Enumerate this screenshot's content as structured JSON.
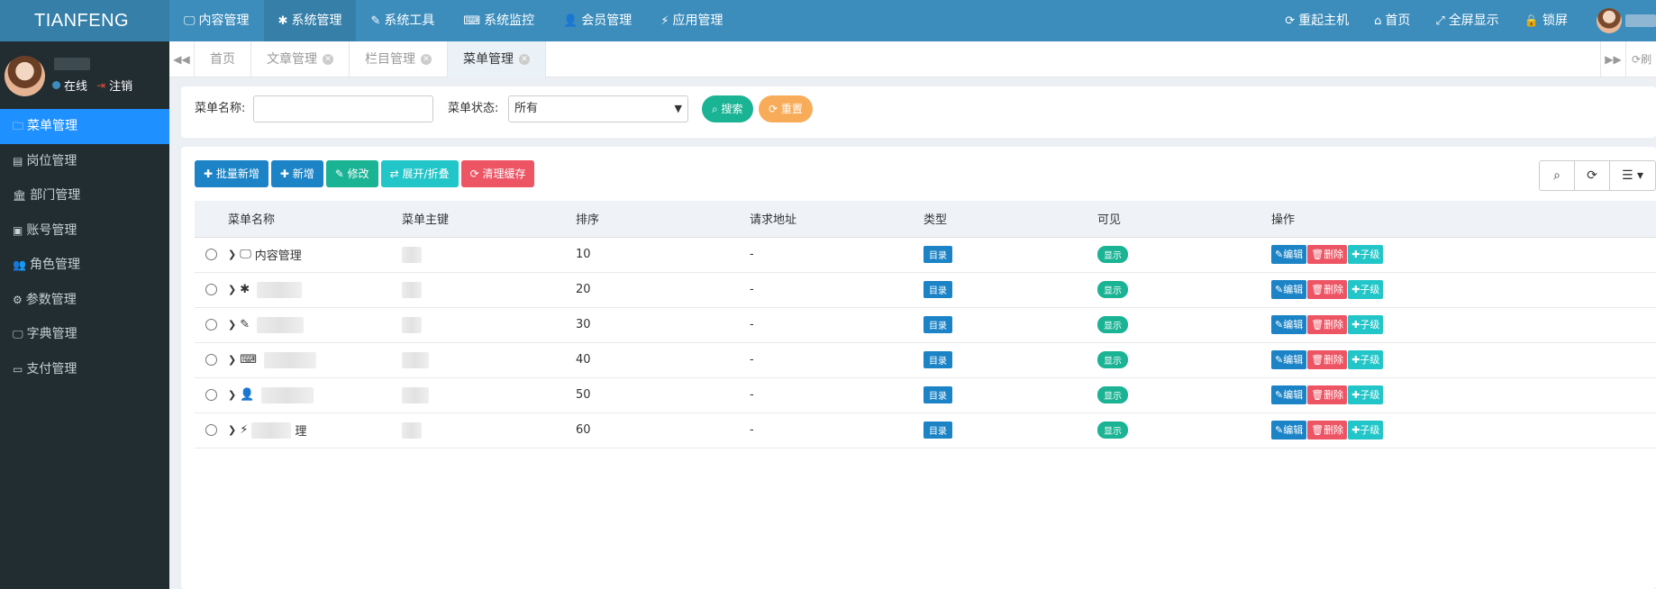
{
  "header": {
    "logo": "TIANFENG",
    "nav": [
      {
        "icon": "monitor-icon",
        "glyph": "🖵",
        "label": "内容管理"
      },
      {
        "icon": "gear-icon",
        "glyph": "✱",
        "label": "系统管理"
      },
      {
        "icon": "wrench-icon",
        "glyph": "✎",
        "label": "系统工具"
      },
      {
        "icon": "keyboard-icon",
        "glyph": "⌨",
        "label": "系统监控"
      },
      {
        "icon": "user-icon",
        "glyph": "👤",
        "label": "会员管理"
      },
      {
        "icon": "plug-icon",
        "glyph": "⚡",
        "label": "应用管理"
      }
    ],
    "right": [
      {
        "icon": "refresh-icon",
        "glyph": "⟳",
        "label": "重起主机"
      },
      {
        "icon": "home-icon",
        "glyph": "⌂",
        "label": "首页"
      },
      {
        "icon": "fullscreen-icon",
        "glyph": "⤢",
        "label": "全屏显示"
      },
      {
        "icon": "lock-icon",
        "glyph": "🔒",
        "label": "锁屏"
      }
    ]
  },
  "sidebar": {
    "status_online": "在线",
    "logout": "注销",
    "items": [
      {
        "icon": "folder-icon",
        "glyph": "🗀",
        "label": "菜单管理"
      },
      {
        "icon": "id-card-icon",
        "glyph": "▤",
        "label": "岗位管理"
      },
      {
        "icon": "bank-icon",
        "glyph": "🏛",
        "label": "部门管理"
      },
      {
        "icon": "account-card-icon",
        "glyph": "▣",
        "label": "账号管理"
      },
      {
        "icon": "users-icon",
        "glyph": "👥",
        "label": "角色管理"
      },
      {
        "icon": "cogs-icon",
        "glyph": "⚙",
        "label": "参数管理"
      },
      {
        "icon": "monitor-icon",
        "glyph": "🖵",
        "label": "字典管理"
      },
      {
        "icon": "money-icon",
        "glyph": "▭",
        "label": "支付管理"
      }
    ]
  },
  "tabs": [
    {
      "label": "首页"
    },
    {
      "label": "文章管理"
    },
    {
      "label": "栏目管理"
    },
    {
      "label": "菜单管理"
    }
  ],
  "tab_refresh": "刷",
  "search": {
    "name_label": "菜单名称:",
    "name_value": "",
    "status_label": "菜单状态:",
    "status_value": "所有",
    "search_btn": "搜索",
    "reset_btn": "重置"
  },
  "toolbar": {
    "batch_add": "批量新增",
    "add": "新增",
    "edit": "修改",
    "expand": "展开/折叠",
    "clear_cache": "清理缓存"
  },
  "table": {
    "columns": [
      "菜单名称",
      "菜单主键",
      "排序",
      "请求地址",
      "类型",
      "可见",
      "操作"
    ],
    "rows": [
      {
        "icon": "monitor-icon",
        "glyph": "🖵",
        "name": "内容管理",
        "sort": "10",
        "url": "-",
        "type": "目录",
        "visible": "显示"
      },
      {
        "icon": "gear-icon",
        "glyph": "✱",
        "name": "",
        "sort": "20",
        "url": "-",
        "type": "目录",
        "visible": "显示"
      },
      {
        "icon": "wrench-icon",
        "glyph": "✎",
        "name": "",
        "sort": "30",
        "url": "-",
        "type": "目录",
        "visible": "显示"
      },
      {
        "icon": "keyboard-icon",
        "glyph": "⌨",
        "name": "",
        "sort": "40",
        "url": "-",
        "type": "目录",
        "visible": "显示"
      },
      {
        "icon": "user-icon",
        "glyph": "👤",
        "name": "",
        "sort": "50",
        "url": "-",
        "type": "目录",
        "visible": "显示"
      },
      {
        "icon": "plug-icon",
        "glyph": "⚡",
        "name": "理",
        "sort": "60",
        "url": "-",
        "type": "目录",
        "visible": "显示"
      }
    ],
    "actions": {
      "edit": "编辑",
      "delete": "删除",
      "child": "子级"
    }
  }
}
